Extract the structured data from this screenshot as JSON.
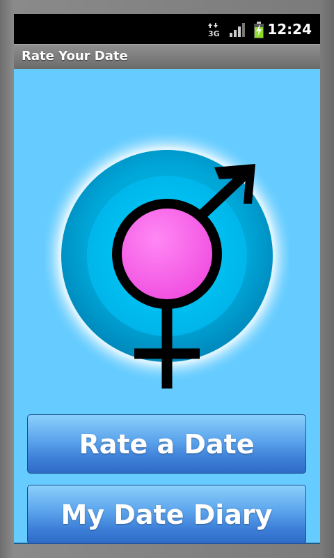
{
  "status_bar": {
    "time": "12:24",
    "network_label": "3G",
    "icons": [
      "data-arrows-icon",
      "signal-icon",
      "battery-charging-icon"
    ]
  },
  "app": {
    "title": "Rate Your Date"
  },
  "logo": {
    "icon": "gender-symbol-icon",
    "outer_circle_color": "#0099cc",
    "inner_circle_color": "#ff66ee",
    "glow_color": "#ffffff"
  },
  "buttons": {
    "rate_label": "Rate a Date",
    "diary_label": "My Date Diary"
  },
  "colors": {
    "background": "#66ccff",
    "button_top": "#8ad0fb",
    "button_bottom": "#2e6bc6"
  }
}
